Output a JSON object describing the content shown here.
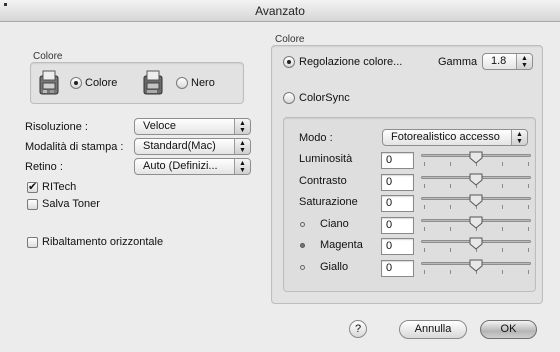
{
  "window": {
    "title": "Avanzato"
  },
  "left": {
    "color_group": {
      "title": "Colore",
      "options": [
        {
          "label": "Colore",
          "selected": true
        },
        {
          "label": "Nero",
          "selected": false
        }
      ]
    },
    "settings": [
      {
        "label": "Risoluzione :",
        "value": "Veloce"
      },
      {
        "label": "Modalità di stampa :",
        "value": "Standard(Mac)"
      },
      {
        "label": "Retino :",
        "value": "Auto (Definizi..."
      }
    ],
    "checkboxes": [
      {
        "label": "RITech",
        "checked": true
      },
      {
        "label": "Salva Toner",
        "checked": false
      },
      {
        "label": "Ribaltamento orizzontale",
        "checked": false
      }
    ]
  },
  "right": {
    "title": "Colore",
    "color_adjust": {
      "label": "Regolazione colore...",
      "selected": true
    },
    "gamma": {
      "label": "Gamma",
      "value": "1.8"
    },
    "colorsync": {
      "label": "ColorSync",
      "selected": false
    },
    "mode": {
      "label": "Modo :",
      "value": "Fotorealistico accesso"
    },
    "adjustments": [
      {
        "label": "Luminosità",
        "value": "0",
        "level": 0.5,
        "bullet": ""
      },
      {
        "label": "Contrasto",
        "value": "0",
        "level": 0.5,
        "bullet": ""
      },
      {
        "label": "Saturazione",
        "value": "0",
        "level": 0.5,
        "bullet": ""
      },
      {
        "label": "Ciano",
        "value": "0",
        "level": 0.5,
        "bullet": "cyan"
      },
      {
        "label": "Magenta",
        "value": "0",
        "level": 0.5,
        "bullet": "magenta"
      },
      {
        "label": "Giallo",
        "value": "0",
        "level": 0.5,
        "bullet": "yellow"
      }
    ]
  },
  "footer": {
    "help": "?",
    "cancel": "Annulla",
    "ok": "OK"
  },
  "icons": {
    "printer_color": "printer-color-icon",
    "printer_black": "printer-black-icon",
    "popup_arrows": "updown-arrows-icon",
    "help": "help-icon"
  }
}
